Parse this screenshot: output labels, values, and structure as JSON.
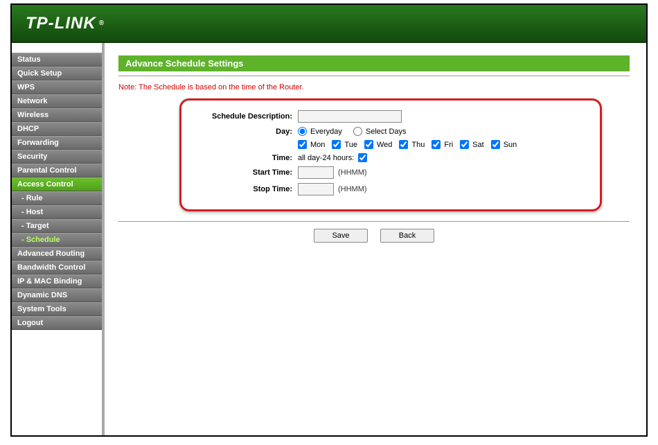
{
  "brand": "TP-LINK",
  "sidebar": {
    "items": [
      {
        "label": "Status",
        "sub": false
      },
      {
        "label": "Quick Setup",
        "sub": false
      },
      {
        "label": "WPS",
        "sub": false
      },
      {
        "label": "Network",
        "sub": false
      },
      {
        "label": "Wireless",
        "sub": false
      },
      {
        "label": "DHCP",
        "sub": false
      },
      {
        "label": "Forwarding",
        "sub": false
      },
      {
        "label": "Security",
        "sub": false
      },
      {
        "label": "Parental Control",
        "sub": false
      },
      {
        "label": "Access Control",
        "sub": false,
        "activeCat": true
      },
      {
        "label": "- Rule",
        "sub": true
      },
      {
        "label": "- Host",
        "sub": true
      },
      {
        "label": "- Target",
        "sub": true
      },
      {
        "label": "- Schedule",
        "sub": true,
        "activeSub": true
      },
      {
        "label": "Advanced Routing",
        "sub": false
      },
      {
        "label": "Bandwidth Control",
        "sub": false
      },
      {
        "label": "IP & MAC Binding",
        "sub": false
      },
      {
        "label": "Dynamic DNS",
        "sub": false
      },
      {
        "label": "System Tools",
        "sub": false
      },
      {
        "label": "Logout",
        "sub": false
      }
    ]
  },
  "page": {
    "title": "Advance Schedule Settings",
    "note": "Note: The Schedule is based on the time of the Router.",
    "labels": {
      "schedule_description": "Schedule Description:",
      "day": "Day:",
      "time": "Time:",
      "start_time": "Start Time:",
      "stop_time": "Stop Time:"
    },
    "day_mode": {
      "everyday": "Everyday",
      "select_days": "Select Days"
    },
    "days": [
      "Mon",
      "Tue",
      "Wed",
      "Thu",
      "Fri",
      "Sat",
      "Sun"
    ],
    "time_allday_label": "all day-24 hours:",
    "hhmm_hint": "(HHMM)",
    "values": {
      "schedule_description": "",
      "day_mode_selected": "everyday",
      "days_checked": [
        true,
        true,
        true,
        true,
        true,
        true,
        true
      ],
      "allday_checked": true,
      "start_time": "",
      "stop_time": ""
    },
    "buttons": {
      "save": "Save",
      "back": "Back"
    }
  }
}
